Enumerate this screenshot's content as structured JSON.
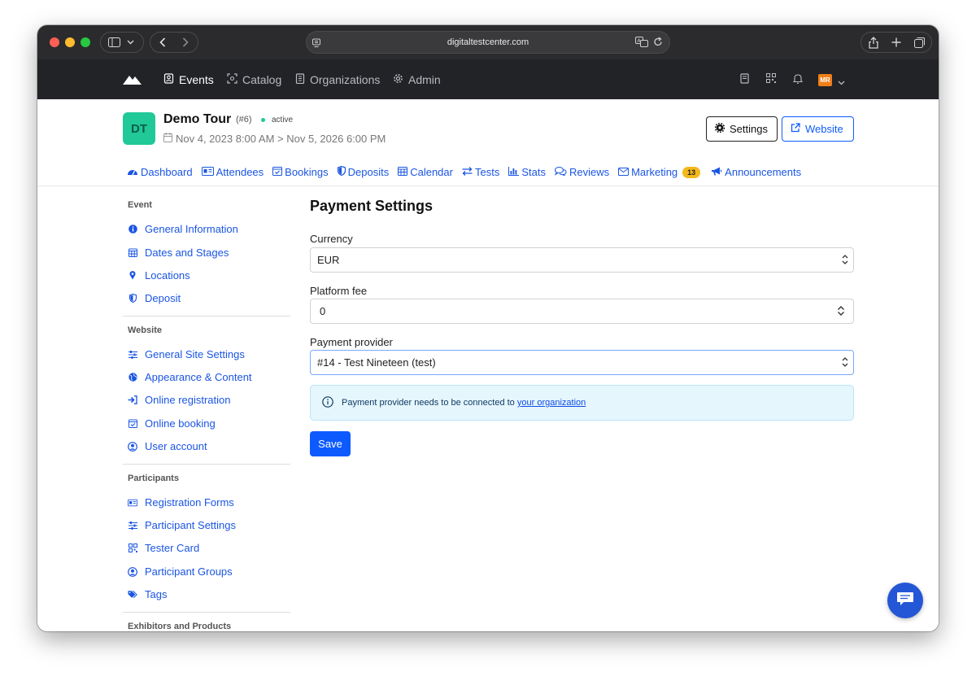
{
  "browser": {
    "url": "digitaltestcenter.com"
  },
  "nav": {
    "items": [
      {
        "label": "Events",
        "icon": "badge-icon",
        "active": true
      },
      {
        "label": "Catalog",
        "icon": "scan-icon",
        "active": false
      },
      {
        "label": "Organizations",
        "icon": "building-icon",
        "active": false
      },
      {
        "label": "Admin",
        "icon": "gear-icon",
        "active": false
      }
    ],
    "user_initials": "MR"
  },
  "event": {
    "avatar": "DT",
    "title": "Demo Tour",
    "id": "(#6)",
    "status": "active",
    "dates": "Nov 4, 2023 8:00 AM > Nov 5, 2026 6:00 PM",
    "settings_label": "Settings",
    "website_label": "Website"
  },
  "tabs": [
    {
      "label": "Dashboard",
      "icon": "dashboard-icon"
    },
    {
      "label": "Attendees",
      "icon": "id-card-icon"
    },
    {
      "label": "Bookings",
      "icon": "calendar-check-icon"
    },
    {
      "label": "Deposits",
      "icon": "shield-icon"
    },
    {
      "label": "Calendar",
      "icon": "calendar-icon"
    },
    {
      "label": "Tests",
      "icon": "exchange-icon"
    },
    {
      "label": "Stats",
      "icon": "bar-chart-icon"
    },
    {
      "label": "Reviews",
      "icon": "comments-icon"
    },
    {
      "label": "Marketing",
      "icon": "envelope-icon",
      "badge": "13"
    },
    {
      "label": "Announcements",
      "icon": "megaphone-icon"
    }
  ],
  "sidebar": {
    "sections": [
      {
        "heading": "Event",
        "items": [
          "General Information",
          "Dates and Stages",
          "Locations",
          "Deposit"
        ]
      },
      {
        "heading": "Website",
        "items": [
          "General Site Settings",
          "Appearance & Content",
          "Online registration",
          "Online booking",
          "User account"
        ]
      },
      {
        "heading": "Participants",
        "items": [
          "Registration Forms",
          "Participant Settings",
          "Tester Card",
          "Participant Groups",
          "Tags"
        ]
      },
      {
        "heading": "Exhibitors and Products",
        "items": []
      }
    ]
  },
  "form": {
    "title": "Payment Settings",
    "currency_label": "Currency",
    "currency_value": "EUR",
    "fee_label": "Platform fee",
    "fee_value": "0",
    "provider_label": "Payment provider",
    "provider_value": "#14 - Test Nineteen (test)",
    "info_text": "Payment provider needs to be connected to",
    "info_link": "your organization",
    "save_label": "Save"
  },
  "colors": {
    "primary": "#0d5bff",
    "nav_bg": "#222327",
    "avatar_bg": "#20c997",
    "badge": "#f3b81a",
    "user_badge": "#f07f19"
  }
}
